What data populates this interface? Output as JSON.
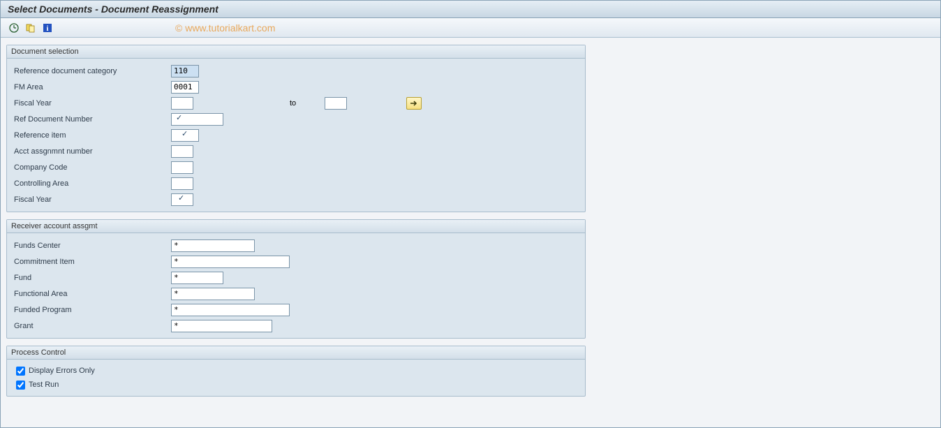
{
  "title": "Select Documents - Document Reassignment",
  "watermark": "© www.tutorialkart.com",
  "docsel": {
    "title": "Document selection",
    "ref_doc_cat_label": "Reference document category",
    "ref_doc_cat_value": "110",
    "fm_area_label": "FM Area",
    "fm_area_value": "0001",
    "fiscal_year_label": "Fiscal Year",
    "fiscal_year_value": "",
    "fiscal_year_to_label": "to",
    "fiscal_year_to_value": "",
    "ref_doc_num_label": "Ref Document Number",
    "ref_doc_num_value": "",
    "ref_item_label": "Reference item",
    "ref_item_value": "",
    "acct_num_label": "Acct assgnmnt number",
    "acct_num_value": "",
    "company_code_label": "Company Code",
    "company_code_value": "",
    "controlling_area_label": "Controlling Area",
    "controlling_area_value": "",
    "fiscal_year2_label": "Fiscal Year",
    "fiscal_year2_value": ""
  },
  "receiver": {
    "title": "Receiver account assgmt",
    "funds_center_label": "Funds Center",
    "funds_center_value": "*",
    "commitment_label": "Commitment Item",
    "commitment_value": "*",
    "fund_label": "Fund",
    "fund_value": "*",
    "func_area_label": "Functional Area",
    "func_area_value": "*",
    "funded_prog_label": "Funded Program",
    "funded_prog_value": "*",
    "grant_label": "Grant",
    "grant_value": "*"
  },
  "process": {
    "title": "Process Control",
    "errors_label": "Display Errors Only",
    "testrun_label": "Test Run"
  }
}
